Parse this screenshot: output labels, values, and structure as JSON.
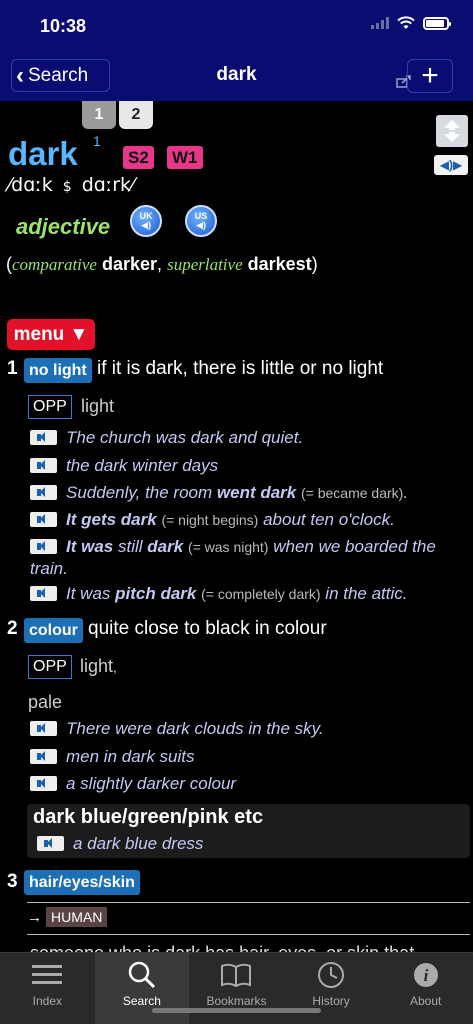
{
  "status": {
    "time": "10:38"
  },
  "nav": {
    "back_label": "Search",
    "title": "dark",
    "add_label": "+"
  },
  "entry": {
    "homograph_tabs": [
      "1",
      "2"
    ],
    "headword": "dark",
    "homograph_number": "1",
    "badges": [
      "S2",
      "W1"
    ],
    "pron_uk": "⁄dɑːk",
    "pron_sep": "$",
    "pron_us": "dɑːrk⁄",
    "pos": "adjective",
    "audio_uk": "UK",
    "audio_us": "US",
    "forms": {
      "open": "(",
      "comparative_label": "comparative",
      "comparative": "darker",
      "comma": ",",
      "superlative_label": "superlative",
      "superlative": "darkest",
      "close": ")"
    },
    "menu_label": "menu ▼"
  },
  "senses": [
    {
      "number": "1",
      "signpost": "no light",
      "definition": "if it is dark, there is little or no light",
      "opp_label": "OPP",
      "opp_word": "light",
      "examples": [
        {
          "pre": "The church was dark and quiet."
        },
        {
          "pre": "the dark winter days"
        },
        {
          "pre": "Suddenly, the room ",
          "bold": "went dark",
          "gloss": "(= became dark)",
          "post": "."
        },
        {
          "bold": "It gets dark",
          "gloss": "(= night begins)",
          "post": "about ten o'clock."
        },
        {
          "bold": "It was",
          "mid": "still",
          "bold2": "dark",
          "gloss": "(= was night)",
          "post": "when we boarded the train."
        },
        {
          "pre": "It was",
          "bold": "pitch dark",
          "gloss": "(= completely dark)",
          "post": "in the attic."
        }
      ]
    },
    {
      "number": "2",
      "signpost": "colour",
      "definition": "quite close to black in colour",
      "opp_label": "OPP",
      "opp_word": "light",
      "opp_sep": ",",
      "opp_word2": "pale",
      "examples": [
        {
          "pre": "There were dark clouds in the sky."
        },
        {
          "pre": "men in dark suits"
        },
        {
          "pre": "a slightly darker colour"
        }
      ],
      "phrase": {
        "title": "dark blue/green/pink etc",
        "example": "a dark blue dress"
      }
    },
    {
      "number": "3",
      "signpost": "hair/eyes/skin",
      "xref_arrow": "→",
      "xref": "HUMAN",
      "cut_text": "someone who is dark has hair, eyes, or skin that"
    }
  ],
  "tabbar": [
    {
      "label": "Index",
      "icon": "index-icon"
    },
    {
      "label": "Search",
      "icon": "search-icon"
    },
    {
      "label": "Bookmarks",
      "icon": "bookmarks-icon"
    },
    {
      "label": "History",
      "icon": "history-icon"
    },
    {
      "label": "About",
      "icon": "about-icon"
    }
  ],
  "colors": {
    "nav_bg": "#0a0c72",
    "headword": "#5ab7ff",
    "pos": "#9be36a",
    "badge": "#e8368a",
    "signpost": "#1d6fb5",
    "menu": "#e3102a",
    "example": "#c4c8f2"
  }
}
